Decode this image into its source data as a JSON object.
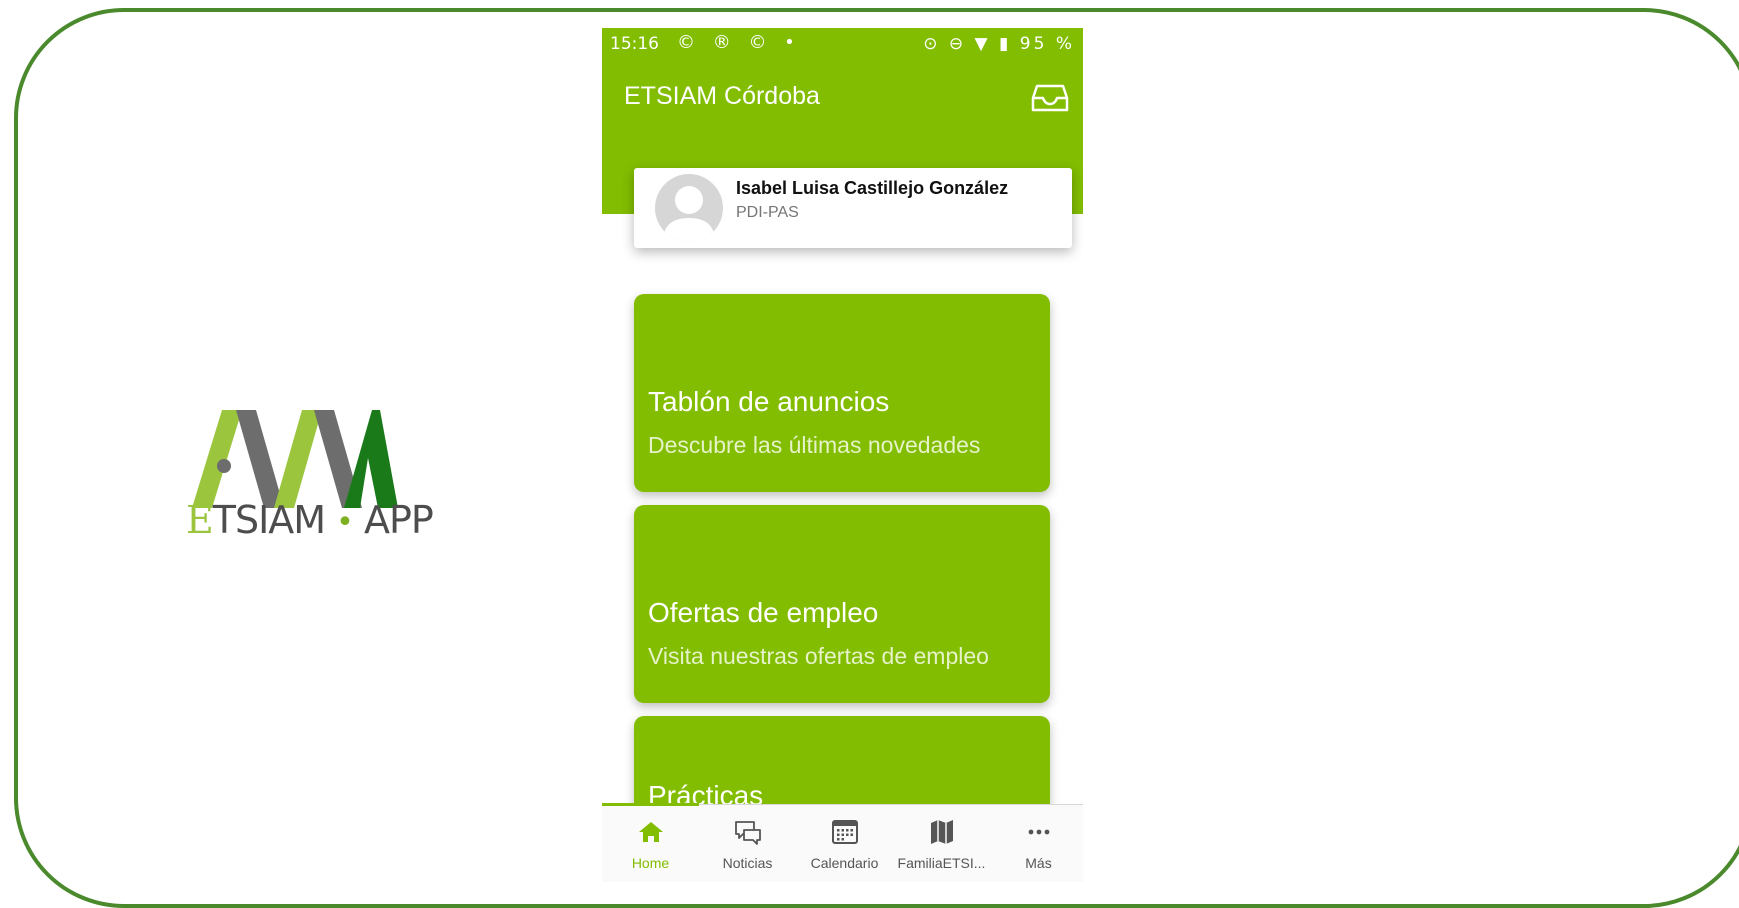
{
  "logo": {
    "brand_e": "E",
    "brand_rest": "TSIAM",
    "separator": "•",
    "app": "APP",
    "colors": {
      "light": "#9bc53d",
      "grey": "#6d6d6d",
      "dark": "#1a7a1a"
    }
  },
  "statusbar": {
    "time": "15:16",
    "notifications": "© ® © •",
    "right": "⊙ ⊖ ▼ ▮ 95 %"
  },
  "appbar": {
    "title": "ETSIAM Córdoba",
    "icon": "inbox-icon"
  },
  "profile": {
    "name": "Isabel Luisa Castillejo González",
    "role": "PDI-PAS"
  },
  "tiles": [
    {
      "title": "Tablón de anuncios",
      "subtitle": "Descubre las últimas novedades"
    },
    {
      "title": "Ofertas de empleo",
      "subtitle": "Visita nuestras ofertas de empleo"
    },
    {
      "title": "Prácticas",
      "subtitle": ""
    }
  ],
  "bottom_nav": [
    {
      "label": "Home",
      "icon": "home-icon",
      "active": true
    },
    {
      "label": "Noticias",
      "icon": "chat-icon",
      "active": false
    },
    {
      "label": "Calendario",
      "icon": "calendar-icon",
      "active": false
    },
    {
      "label": "FamiliaETSI...",
      "icon": "map-icon",
      "active": false
    },
    {
      "label": "Más",
      "icon": "more-icon",
      "active": false
    }
  ],
  "colors": {
    "primary": "#82bd01",
    "frame": "#4a8a2c"
  }
}
